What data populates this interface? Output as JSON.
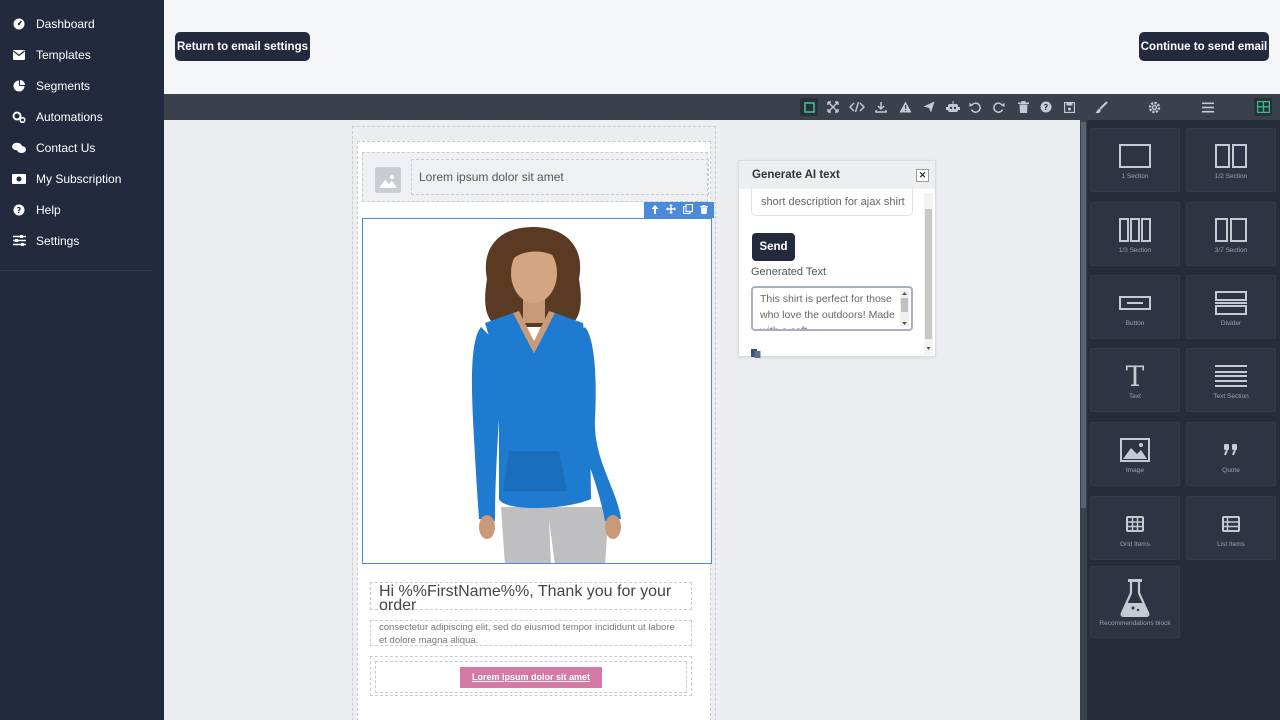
{
  "sidebar": {
    "items": [
      {
        "label": "Dashboard",
        "icon": "dashboard-icon"
      },
      {
        "label": "Templates",
        "icon": "envelope-icon"
      },
      {
        "label": "Segments",
        "icon": "pie-chart-icon"
      },
      {
        "label": "Automations",
        "icon": "cogs-icon"
      },
      {
        "label": "Contact Us",
        "icon": "chat-icon"
      },
      {
        "label": "My Subscription",
        "icon": "money-icon"
      },
      {
        "label": "Help",
        "icon": "help-icon"
      },
      {
        "label": "Settings",
        "icon": "sliders-icon"
      }
    ]
  },
  "header": {
    "return_label": "Return to email settings",
    "continue_label": "Continue to send email"
  },
  "email": {
    "header_text": "Lorem ipsum dolor sit amet",
    "title": "Hi %%FirstName%%, Thank you for your order",
    "body": "consectetur adipiscing elit, sed do eiusmod tempor incididunt ut labore et dolore magna aliqua.",
    "cta": "Lorem ipsum dolor sit amet"
  },
  "ai_popup": {
    "title": "Generate AI text",
    "prompt_value": "short description for ajax shirt",
    "send_label": "Send",
    "generated_label": "Generated Text",
    "generated_value": "This shirt is perfect for those who love the outdoors! Made with a soft"
  },
  "blocks": [
    {
      "label": "1 Section",
      "icon": "one-section-icon"
    },
    {
      "label": "1/2 Section",
      "icon": "half-section-icon"
    },
    {
      "label": "1/3 Section",
      "icon": "third-section-icon"
    },
    {
      "label": "3/7 Section",
      "icon": "three-seven-section-icon"
    },
    {
      "label": "Button",
      "icon": "button-block-icon"
    },
    {
      "label": "Divider",
      "icon": "divider-icon"
    },
    {
      "label": "Text",
      "icon": "text-icon"
    },
    {
      "label": "Text Section",
      "icon": "text-section-icon"
    },
    {
      "label": "Image",
      "icon": "image-icon"
    },
    {
      "label": "Quote",
      "icon": "quote-icon"
    },
    {
      "label": "Grid Items",
      "icon": "grid-items-icon"
    },
    {
      "label": "List Items",
      "icon": "list-items-icon"
    },
    {
      "label": "Recommendations block",
      "icon": "flask-icon"
    }
  ],
  "colors": {
    "sidebar_bg": "#232a3d",
    "toolbar_bg": "#3a404c",
    "accent_green": "#34c38f",
    "selection_blue": "#4b8ad8",
    "cta_pink": "#d57aa5",
    "shirt_blue": "#1e7bd0"
  }
}
